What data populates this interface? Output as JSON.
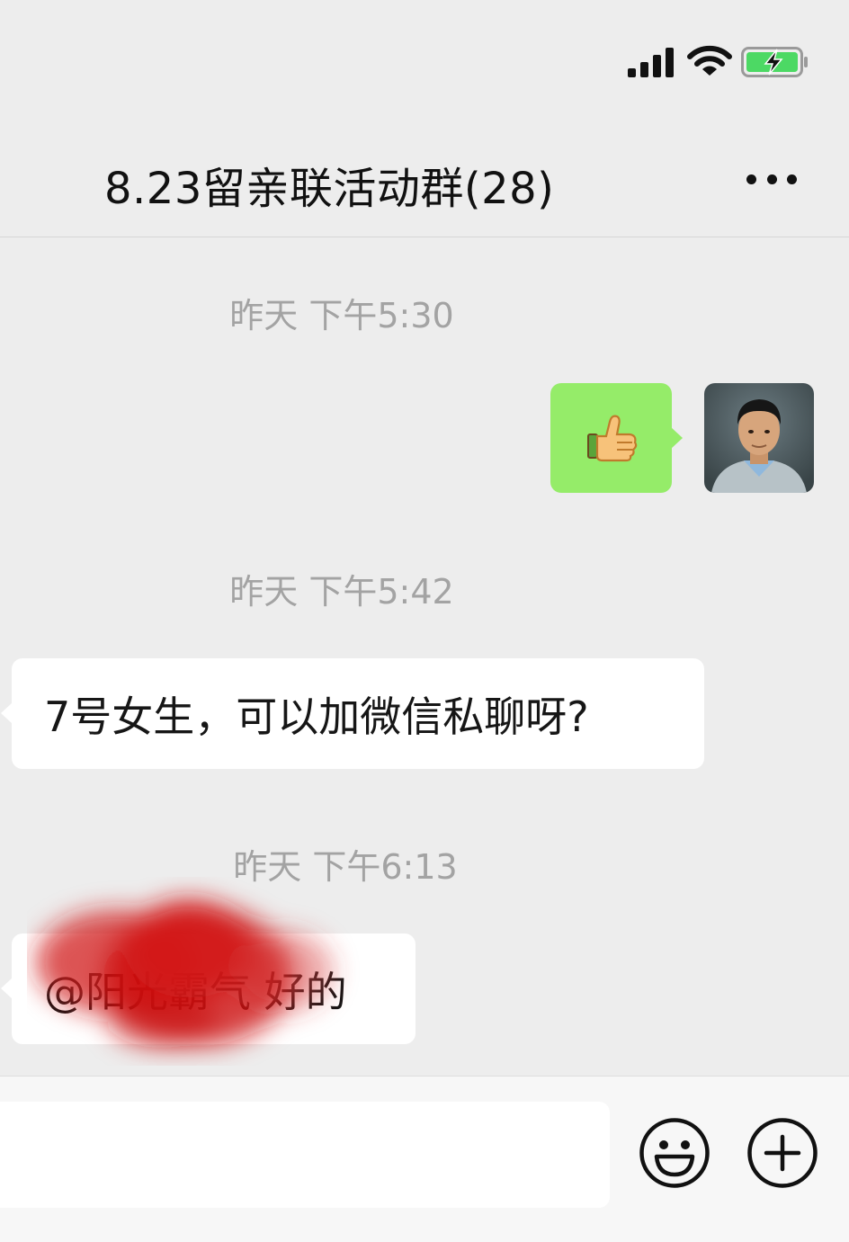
{
  "header": {
    "title": "8.23留亲联活动群(28)"
  },
  "messages": [
    {
      "type": "timestamp",
      "text": "昨天 下午5:30"
    },
    {
      "type": "sent",
      "content": "👍"
    },
    {
      "type": "timestamp",
      "text": "昨天 下午5:42"
    },
    {
      "type": "received",
      "text": "7号女生，可以加微信私聊呀?"
    },
    {
      "type": "timestamp",
      "text": "昨天 下午6:13"
    },
    {
      "type": "received",
      "text": "@阳光霸气 好的"
    }
  ],
  "input": {
    "value": "",
    "placeholder": ""
  },
  "icons": {
    "signal": "signal-strength-icon",
    "wifi": "wifi-icon",
    "battery": "battery-charging-icon",
    "more": "more-dots-icon",
    "emoji": "emoji-icon",
    "add": "plus-icon"
  },
  "colors": {
    "background": "#ededed",
    "sent_bubble": "#95ec69",
    "received_bubble": "#ffffff",
    "timestamp_text": "#a3a3a3",
    "battery_fill": "#4cd964"
  }
}
